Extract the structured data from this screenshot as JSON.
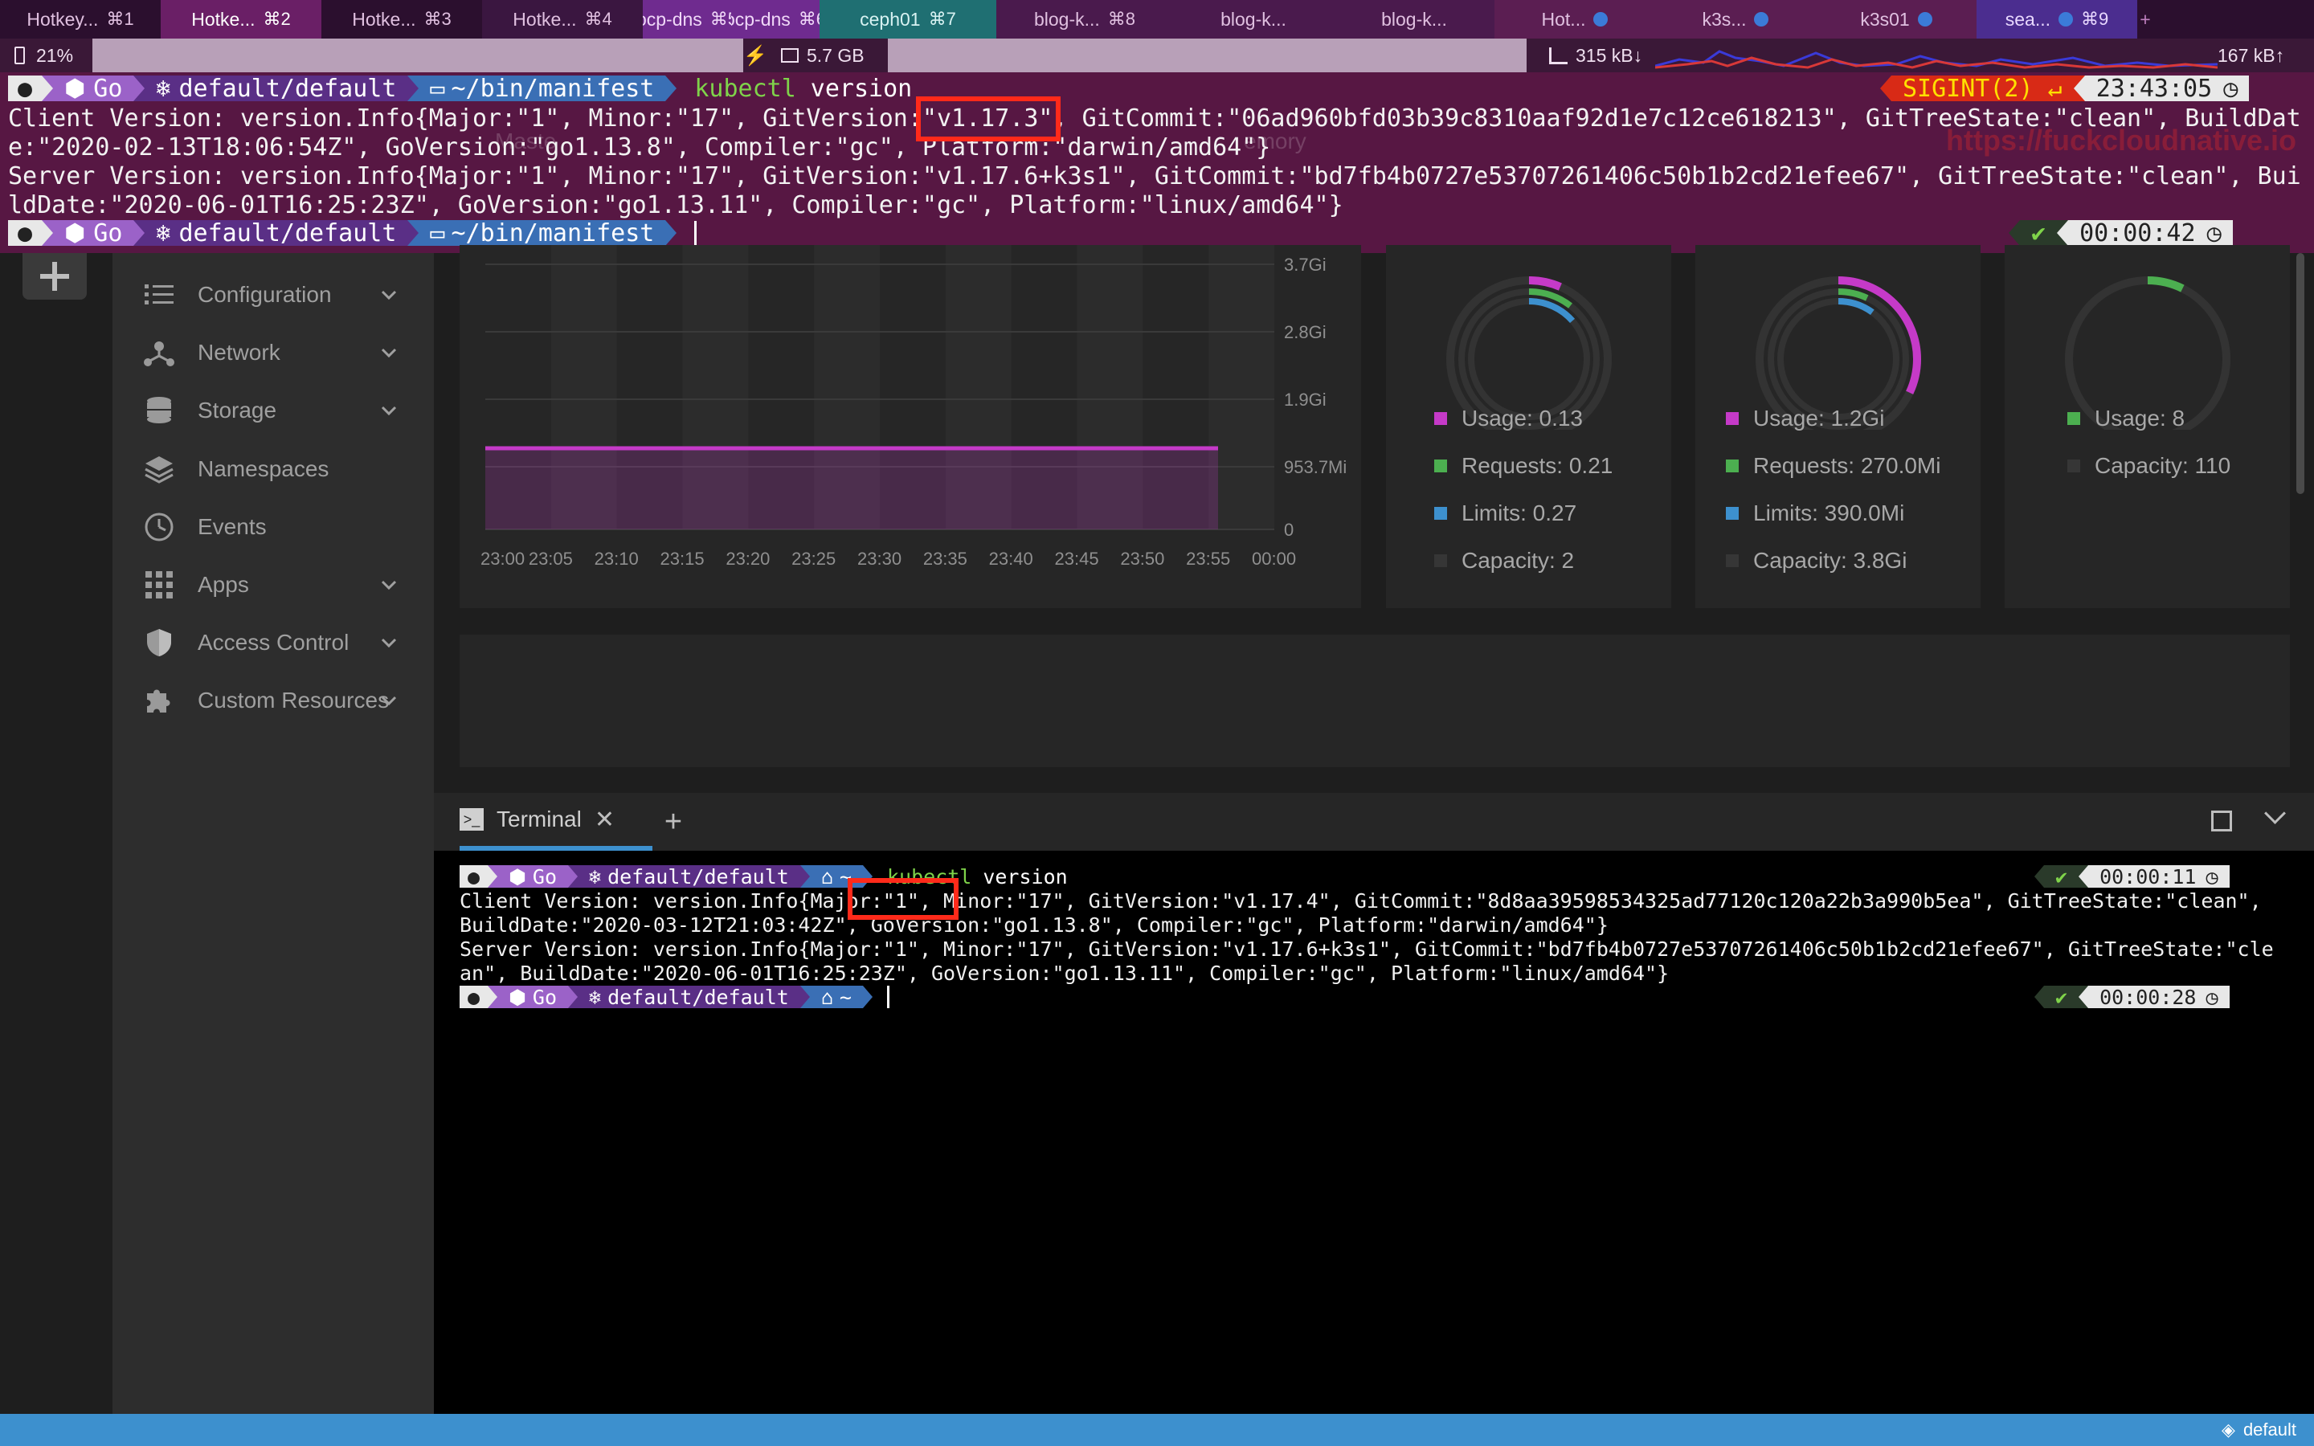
{
  "tabs": [
    {
      "label": "Hotkey...",
      "shortcut": "⌘1",
      "bg": "#2b0f2e",
      "color": "#e0c0e0",
      "dot": false
    },
    {
      "label": "Hotke...",
      "shortcut": "⌘2",
      "bg": "#6a1f66",
      "color": "#ffffff",
      "dot": false
    },
    {
      "label": "Hotke...",
      "shortcut": "⌘3",
      "bg": "#2b0f2e",
      "color": "#e0c0e0",
      "dot": false
    },
    {
      "label": "Hotke...",
      "shortcut": "⌘4",
      "bg": "#3a1640",
      "color": "#e0c0e0",
      "dot": false
    },
    {
      "label": "ocp-dns",
      "shortcut": "⌘5",
      "bg": "#6f2b8f",
      "color": "#f0d8f8",
      "dot": false
    },
    {
      "label": "ocp-dns",
      "shortcut": "⌘6",
      "bg": "#6f2b8f",
      "color": "#f0d8f8",
      "dot": false
    },
    {
      "label": "ceph01",
      "shortcut": "⌘7",
      "bg": "#1f6f72",
      "color": "#d8f2f2",
      "dot": false
    },
    {
      "label": "blog-k...",
      "shortcut": "⌘8",
      "bg": "#4a1a4d",
      "color": "#e0c0e0",
      "dot": false
    },
    {
      "label": "blog-k...",
      "shortcut": "",
      "bg": "#4a1a4d",
      "color": "#e0c0e0",
      "dot": false
    },
    {
      "label": "blog-k...",
      "shortcut": "",
      "bg": "#4a1a4d",
      "color": "#e0c0e0",
      "dot": false
    },
    {
      "label": "Hot...",
      "shortcut": "",
      "bg": "#5b1e52",
      "color": "#e0c0e0",
      "dot": true
    },
    {
      "label": "k3s...",
      "shortcut": "",
      "bg": "#5b1e52",
      "color": "#e0c0e0",
      "dot": true
    },
    {
      "label": "k3s01",
      "shortcut": "",
      "bg": "#5b1e52",
      "color": "#e0c0e0",
      "dot": true
    },
    {
      "label": "sea...",
      "shortcut": "⌘9",
      "bg": "#4b2d8f",
      "color": "#e8d8ff",
      "dot": true
    },
    {
      "label": "+",
      "shortcut": "",
      "bg": "#2b0f2e",
      "color": "#c080c0",
      "dot": false
    }
  ],
  "status": {
    "battery": "21%",
    "memory": "5.7 GB",
    "net_down": "315 kB↓",
    "net_up": "167 kB↑"
  },
  "top_terminal": {
    "prompt": {
      "os": "",
      "ruby": "Go",
      "kube": "default/default",
      "dir": "~/bin/manifest"
    },
    "command_name": "kubectl",
    "command_arg": "version",
    "sigint": "SIGINT(2) ↵",
    "time1": "23:43:05",
    "line1a": "Client Version: version.Info{Major:\"1\", Minor:\"17\", GitVersion:",
    "line1b": "\"v1.17.3\"",
    "line1c": ", GitCommit:\"06ad960bfd03b39c8310aaf92d1e7c12ce618213\", GitTreeState:\"clean\", BuildDat",
    "line2": "e:\"2020-02-13T18:06:54Z\", GoVersion:\"go1.13.8\", Compiler:\"gc\", Platform:\"darwin/amd64\"}",
    "line3": "Server Version: version.Info{Major:\"1\", Minor:\"17\", GitVersion:\"v1.17.6+k3s1\", GitCommit:\"bd7fb4b0727e53707261406c50b1b2cd21efee67\", GitTreeState:\"clean\", Bui",
    "line4": "ldDate:\"2020-06-01T16:25:23Z\", GoVersion:\"go1.13.11\", Compiler:\"gc\", Platform:\"linux/amd64\"}",
    "check": "✔",
    "time2": "00:00:42",
    "watermark": "https://fuckcloudnative.io",
    "ghost_master": "Maste",
    "ghost_memory": "emory"
  },
  "sidebar": {
    "items": [
      {
        "label": "Configuration",
        "icon": "list-icon",
        "chevron": true
      },
      {
        "label": "Network",
        "icon": "network-icon",
        "chevron": true
      },
      {
        "label": "Storage",
        "icon": "storage-icon",
        "chevron": true
      },
      {
        "label": "Namespaces",
        "icon": "layers-icon",
        "chevron": false
      },
      {
        "label": "Events",
        "icon": "clock-icon",
        "chevron": false
      },
      {
        "label": "Apps",
        "icon": "apps-icon",
        "chevron": true
      },
      {
        "label": "Access Control",
        "icon": "shield-icon",
        "chevron": true
      },
      {
        "label": "Custom Resources",
        "icon": "puzzle-icon",
        "chevron": true
      }
    ]
  },
  "memory_chart": {
    "y_ticks": [
      "3.7Gi",
      "2.8Gi",
      "1.9Gi",
      "953.7Mi",
      "0"
    ],
    "x_ticks": [
      "23:00",
      "23:05",
      "23:10",
      "23:15",
      "23:20",
      "23:25",
      "23:30",
      "23:35",
      "23:40",
      "23:45",
      "23:50",
      "23:55",
      "00:00"
    ],
    "series_color": "#c53ac8"
  },
  "cpu_card": {
    "usage": "Usage: 0.13",
    "requests": "Requests: 0.21",
    "limits": "Limits: 0.27",
    "capacity": "Capacity: 2",
    "usage_fraction": 0.065,
    "requests_fraction": 0.105,
    "limits_fraction": 0.135
  },
  "memory_card": {
    "usage": "Usage: 1.2Gi",
    "requests": "Requests: 270.0Mi",
    "limits": "Limits: 390.0Mi",
    "capacity": "Capacity: 3.8Gi",
    "usage_fraction": 0.32,
    "requests_fraction": 0.07,
    "limits_fraction": 0.1
  },
  "pods_card": {
    "usage": "Usage: 8",
    "capacity": "Capacity: 110",
    "usage_fraction": 0.073
  },
  "colors": {
    "usage": "#c53ac8",
    "requests": "#4caf50",
    "limits": "#3d90ce",
    "capacity": "#363636"
  },
  "dock": {
    "tab_label": "Terminal",
    "prompt": {
      "ruby": "Go",
      "kube": "default/default",
      "dir": "~"
    },
    "command_name": "kubectl",
    "command_arg": "version",
    "check": "✔",
    "time1": "00:00:11",
    "line1a": "Client Version: version.Info{Major:\"1\", Minor:\"17\", GitVersion:",
    "line1b": "\"v1.17.4\"",
    "line1c": ", GitCommit:\"8d8aa39598534325ad77120c120a22b3a990b5ea\", GitTreeState:\"clean\",",
    "line2": "BuildDate:\"2020-03-12T21:03:42Z\", GoVersion:\"go1.13.8\", Compiler:\"gc\", Platform:\"darwin/amd64\"}",
    "line3": "Server Version: version.Info{Major:\"1\", Minor:\"17\", GitVersion:\"v1.17.6+k3s1\", GitCommit:\"bd7fb4b0727e53707261406c50b1b2cd21efee67\", GitTreeState:\"cle",
    "line4": "an\", BuildDate:\"2020-06-01T16:25:23Z\", GoVersion:\"go1.13.11\", Compiler:\"gc\", Platform:\"linux/amd64\"}",
    "time2": "00:00:28"
  },
  "footer": {
    "namespace": "default"
  }
}
